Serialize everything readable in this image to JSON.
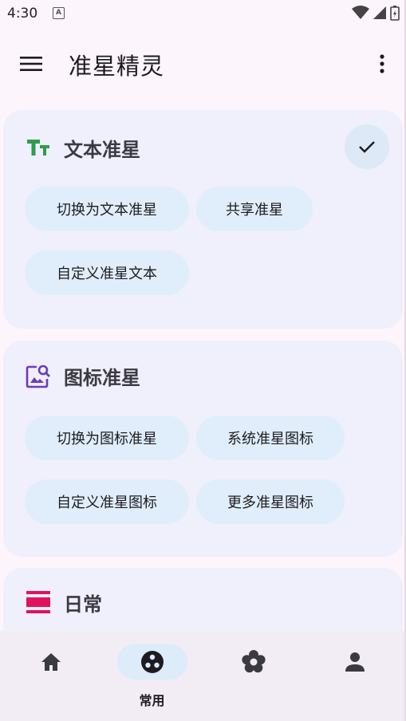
{
  "status_bar": {
    "time": "4:30",
    "notification_icon": "A"
  },
  "app_bar": {
    "title": "准星精灵"
  },
  "cards": {
    "text": {
      "title": "文本准星",
      "selected": true,
      "icon": "text-size-icon",
      "icon_color": "#2e9d4a",
      "chips": [
        "切换为文本准星",
        "共享准星",
        "自定义准星文本"
      ]
    },
    "icon": {
      "title": "图标准星",
      "icon": "image-search-icon",
      "icon_color": "#6a3db8",
      "chips": [
        "切换为图标准星",
        "系统准星图标",
        "自定义准星图标",
        "更多准星图标"
      ]
    },
    "daily": {
      "title": "日常",
      "icon": "view-day-icon",
      "icon_color": "#e0135c"
    }
  },
  "bottom_nav": {
    "items": [
      {
        "name": "home",
        "icon": "home-icon",
        "label": ""
      },
      {
        "name": "common",
        "icon": "scatter-icon",
        "label": "常用",
        "active": true
      },
      {
        "name": "settings",
        "icon": "flower-gear-icon",
        "label": ""
      },
      {
        "name": "profile",
        "icon": "person-icon",
        "label": ""
      }
    ]
  }
}
